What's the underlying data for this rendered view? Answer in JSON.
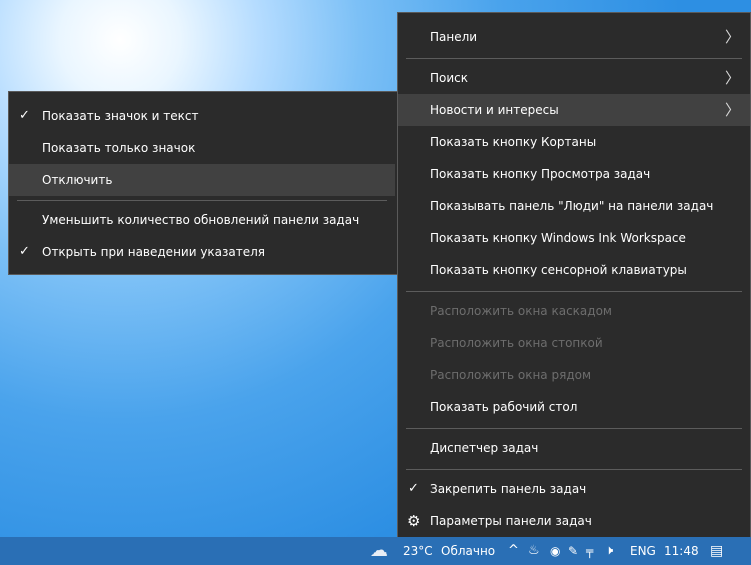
{
  "main_menu": {
    "items": [
      {
        "label": "Панели"
      },
      {
        "label": "Поиск"
      },
      {
        "label": "Новости и интересы"
      },
      {
        "label": "Показать кнопку Кортаны"
      },
      {
        "label": "Показать кнопку Просмотра задач"
      },
      {
        "label": "Показывать панель \"Люди\" на панели задач"
      },
      {
        "label": "Показать кнопку Windows Ink Workspace"
      },
      {
        "label": "Показать кнопку сенсорной клавиатуры"
      },
      {
        "label": "Расположить окна каскадом"
      },
      {
        "label": "Расположить окна стопкой"
      },
      {
        "label": "Расположить окна рядом"
      },
      {
        "label": "Показать рабочий стол"
      },
      {
        "label": "Диспетчер задач"
      },
      {
        "label": "Закрепить панель задач"
      },
      {
        "label": "Параметры панели задач"
      }
    ]
  },
  "sub_menu": {
    "items": [
      {
        "label": "Показать значок и текст"
      },
      {
        "label": "Показать только значок"
      },
      {
        "label": "Отключить"
      },
      {
        "label": "Уменьшить количество обновлений панели задач"
      },
      {
        "label": "Открыть при наведении указателя"
      }
    ]
  },
  "icons": {
    "chevron": "chevron-right-icon",
    "check": "checkmark-icon",
    "gear": "gear-icon",
    "weather": "cloud-icon",
    "tray_up": "chevron-up-icon",
    "notifications": "notification-icon"
  },
  "taskbar": {
    "temperature": "23°C",
    "condition": "Облачно",
    "language": "ENG",
    "time": "11:48"
  },
  "colors": {
    "menu_bg": "#2b2b2b",
    "menu_highlight": "#414141",
    "disabled_text": "#6d6d6d",
    "taskbar_bg": "#2a6fb5"
  }
}
